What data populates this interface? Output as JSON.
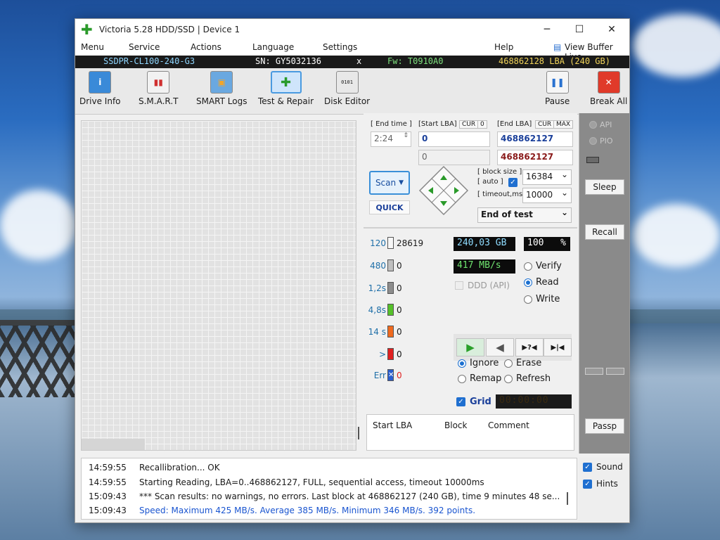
{
  "window": {
    "title": "Victoria 5.28 HDD/SSD | Device 1"
  },
  "menu": {
    "items": [
      "Menu",
      "Service",
      "Actions",
      "Language",
      "Settings",
      "Help"
    ],
    "view_buffer": "View Buffer Live"
  },
  "info": {
    "model": "SSDPR-CL100-240-G3",
    "serial": "SN: GY5032136",
    "close": "x",
    "firmware": "Fw: T0910A0",
    "capacity": "468862128 LBA (240 GB)"
  },
  "toolbar": {
    "drive_info": "Drive Info",
    "smart": "S.M.A.R.T",
    "smart_logs": "SMART Logs",
    "test_repair": "Test & Repair",
    "disk_editor": "Disk Editor",
    "pause": "Pause",
    "break_all": "Break All"
  },
  "side": {
    "api": "API",
    "pio": "PIO",
    "sleep": "Sleep",
    "recall": "Recall",
    "passp": "Passp",
    "sound": "Sound",
    "hints": "Hints"
  },
  "scan": {
    "end_time_label": "[ End time ]",
    "end_time": "2:24",
    "start_lba_label": "[Start LBA]",
    "cur": "CUR",
    "zero_tag": "0",
    "start_lba": "0",
    "start_lba_cur": "0",
    "end_lba_label": "[End LBA]",
    "max": "MAX",
    "end_lba": "468862127",
    "end_lba_cur": "468862127",
    "scan_button": "Scan",
    "quick": "QUICK",
    "block_size_label": "[ block size ]",
    "auto_label": "[ auto ]",
    "block_size": "16384",
    "timeout_label": "[ timeout,ms ]",
    "timeout": "10000",
    "end_action": "End of test"
  },
  "legend": [
    {
      "ms": "120",
      "count": "28619",
      "color": "#f7f7f7"
    },
    {
      "ms": "480",
      "count": "0",
      "color": "#c0c0c0"
    },
    {
      "ms": "1,2s",
      "count": "0",
      "color": "#8d8d8d"
    },
    {
      "ms": "4,8s",
      "count": "0",
      "color": "#56c12a"
    },
    {
      "ms": "14 s",
      "count": "0",
      "color": "#f06a1e"
    },
    {
      "ms": ">",
      "count": "0",
      "color": "#e02020"
    },
    {
      "ms": "Err",
      "count": "0",
      "color": "#2a5ed0"
    }
  ],
  "stats": {
    "size": "240,03 GB",
    "percent": "100",
    "percent_unit": "%",
    "speed": "417 MB/s",
    "ddd": "DDD (API)",
    "timer": "00:00:00"
  },
  "mode": {
    "verify": "Verify",
    "read": "Read",
    "write": "Write",
    "selected": "Read"
  },
  "repair": {
    "ignore": "Ignore",
    "erase": "Erase",
    "remap": "Remap",
    "refresh": "Refresh",
    "selected": "Ignore"
  },
  "grid_label": "Grid",
  "results": {
    "col_start": "Start LBA",
    "col_block": "Block",
    "col_comment": "Comment"
  },
  "log": [
    {
      "time": "14:59:55",
      "text": "Recallibration... OK",
      "color": "#1a1a1a"
    },
    {
      "time": "14:59:55",
      "text": "Starting Reading, LBA=0..468862127, FULL, sequential access, timeout 10000ms",
      "color": "#1a1a1a"
    },
    {
      "time": "15:09:43",
      "text": "*** Scan results: no warnings, no errors. Last block at 468862127 (240 GB), time 9 minutes 48 se...",
      "color": "#1a1a1a"
    },
    {
      "time": "15:09:43",
      "text": "Speed: Maximum 425 MB/s. Average 385 MB/s. Minimum 346 MB/s. 392 points.",
      "color": "#1a55d0"
    }
  ]
}
